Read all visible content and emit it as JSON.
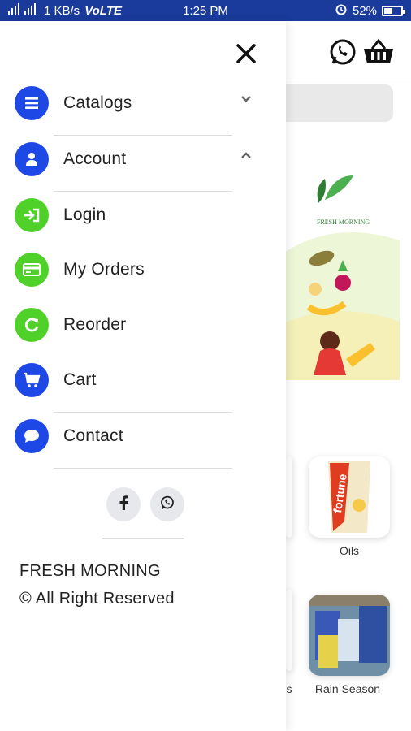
{
  "status_bar": {
    "network": "1 KB/s",
    "volte": "VoLTE",
    "time": "1:25 PM",
    "battery": "52%",
    "battery_level": 0.52
  },
  "drawer": {
    "menu": [
      {
        "label": "Catalogs",
        "icon": "list-icon",
        "color": "#1e48e6",
        "chevron": "down"
      },
      {
        "label": "Account",
        "icon": "user-icon",
        "color": "#1e48e6",
        "chevron": "up"
      },
      {
        "label": "Login",
        "icon": "sign-in-icon",
        "color": "#4fd12a"
      },
      {
        "label": "My Orders",
        "icon": "credit-card-icon",
        "color": "#4fd12a"
      },
      {
        "label": "Reorder",
        "icon": "refresh-icon",
        "color": "#4fd12a"
      },
      {
        "label": "Cart",
        "icon": "cart-icon",
        "color": "#1e48e6"
      },
      {
        "label": "Contact",
        "icon": "chat-bubble-icon",
        "color": "#1e48e6"
      }
    ],
    "social": [
      "facebook-icon",
      "whatsapp-icon"
    ],
    "footer": {
      "brand": "FRESH MORNING",
      "rights": "© All Right Reserved"
    }
  },
  "background": {
    "banner_brand": "FRESH MORNING",
    "products": [
      {
        "label": "Oils",
        "brand_text": "fortune"
      },
      {
        "label": "Rain Season"
      }
    ],
    "cropped_label": "s"
  }
}
